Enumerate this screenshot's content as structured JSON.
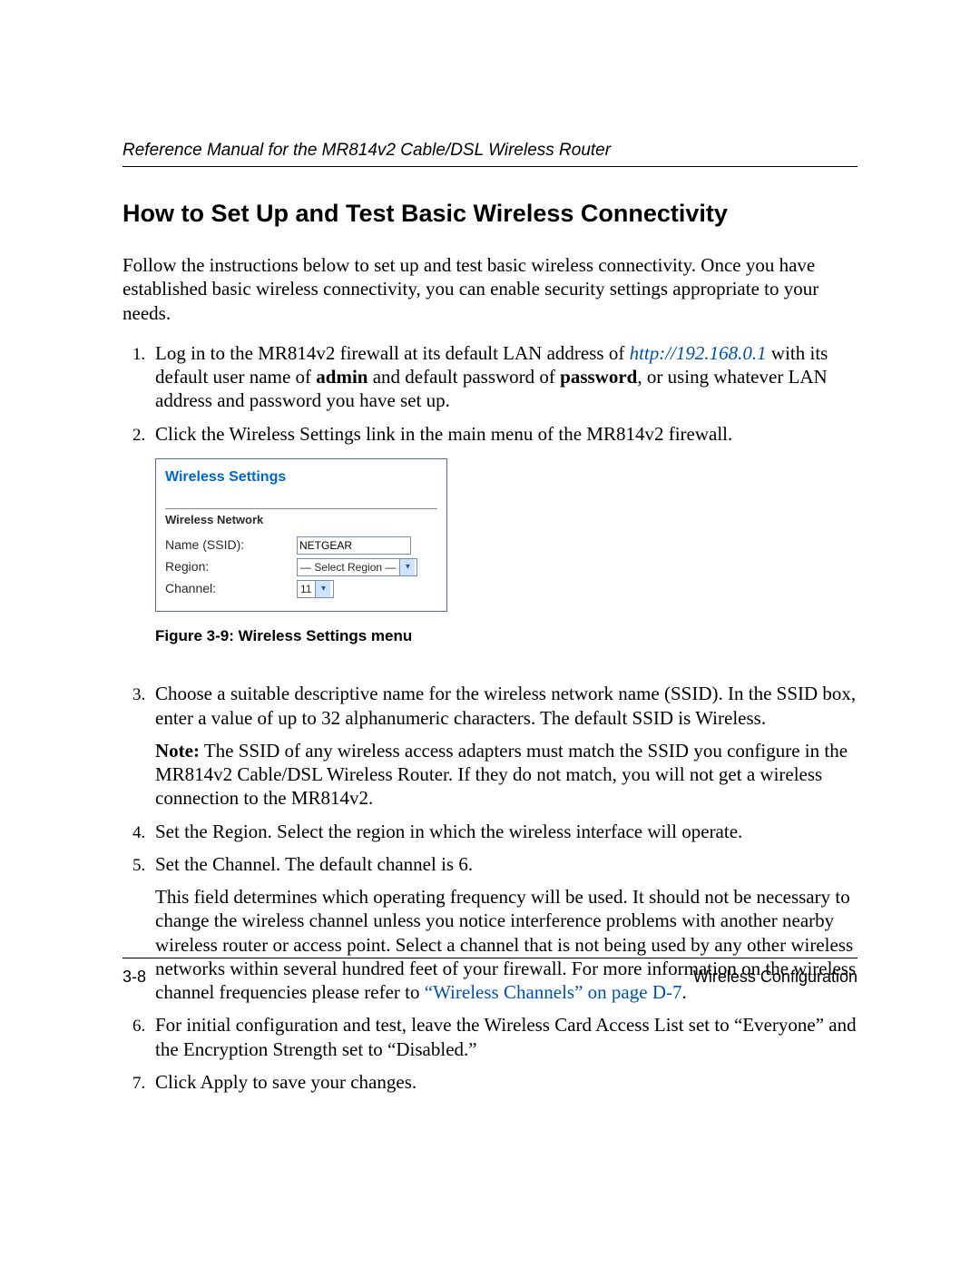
{
  "header": {
    "running_head": "Reference Manual for the MR814v2 Cable/DSL Wireless Router"
  },
  "title": "How to Set Up and Test Basic Wireless Connectivity",
  "intro": "Follow the instructions below to set up and test basic wireless connectivity. Once you have established basic wireless connectivity, you can enable security settings appropriate to your needs.",
  "steps": {
    "s1": {
      "pre": "Log in to the MR814v2 firewall at its default LAN address of ",
      "link": "http://192.168.0.1",
      "mid1": " with its default user name of ",
      "admin": "admin",
      "mid2": " and default password of ",
      "password": "password",
      "post": ", or using whatever LAN address and password you have set up."
    },
    "s2": "Click the Wireless Settings link in the main menu of the MR814v2 firewall.",
    "s3": {
      "p1": "Choose a suitable descriptive name for the wireless network name (SSID). In the SSID box, enter a value of up to 32 alphanumeric characters. The default SSID is Wireless.",
      "note_label": "Note:",
      "note_body": " The SSID of any wireless access adapters must match the SSID you configure in the MR814v2 Cable/DSL Wireless Router. If they do not match, you will not get a wireless connection to the MR814v2."
    },
    "s4": "Set the Region. Select the region in which the wireless interface will operate.",
    "s5": {
      "p1": "Set the Channel. The default channel is 6.",
      "p2_pre": "This field determines which operating frequency will be used. It should not be necessary to change the wireless channel unless you notice interference problems with another nearby wireless router or access point. Select a channel that is not being used by any other wireless networks within several hundred feet of your firewall. For more information on the wireless channel frequencies please refer to ",
      "p2_link": "“Wireless Channels” on page D-7",
      "p2_post": "."
    },
    "s6": "For initial configuration and test, leave the Wireless Card Access List set to “Everyone” and the Encryption Strength set to “Disabled.”",
    "s7": "Click Apply to save your changes."
  },
  "figure": {
    "panel_title": "Wireless Settings",
    "section": "Wireless Network",
    "rows": {
      "ssid_label": "Name (SSID):",
      "ssid_value": "NETGEAR",
      "region_label": "Region:",
      "region_value": "— Select Region —",
      "channel_label": "Channel:",
      "channel_value": "11"
    },
    "caption": "Figure 3-9:  Wireless Settings menu"
  },
  "footer": {
    "left": "3-8",
    "right": "Wireless Configuration"
  }
}
